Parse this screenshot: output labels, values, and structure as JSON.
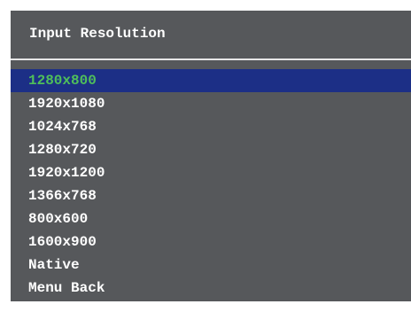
{
  "osd": {
    "title": "Input Resolution",
    "selected_index": 0,
    "items": [
      {
        "label": "1280x800"
      },
      {
        "label": "1920x1080"
      },
      {
        "label": "1024x768"
      },
      {
        "label": "1280x720"
      },
      {
        "label": "1920x1200"
      },
      {
        "label": "1366x768"
      },
      {
        "label": "800x600"
      },
      {
        "label": "1600x900"
      },
      {
        "label": "Native"
      },
      {
        "label": "Menu Back"
      }
    ]
  },
  "colors": {
    "panel_bg": "#56585b",
    "selected_bg": "#1c2f86",
    "selected_text": "#4fbf5a",
    "text": "#ffffff",
    "divider": "#e6e6e6"
  }
}
